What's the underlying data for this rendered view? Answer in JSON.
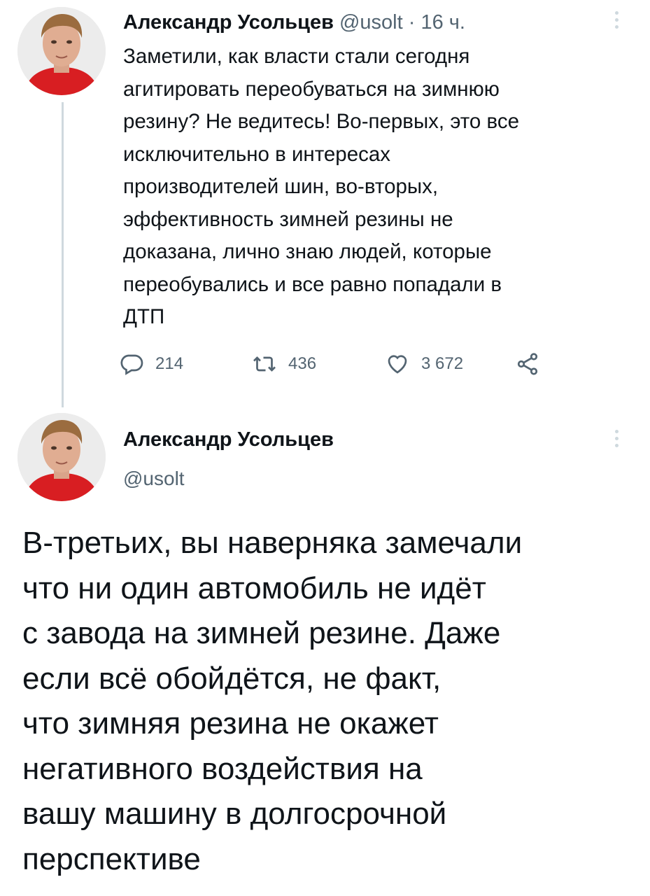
{
  "tweet1": {
    "author_name": "Александр Усольцев",
    "meta": "@usolt · 16 ч.",
    "text": "Заметили, как власти стали сегодня\nагитировать переобуваться на зимнюю\nрезину? Не ведитесь! Во-первых, это все\nисключительно в интересах\nпроизводителей шин, во-вторых,\nэффективность зимней резины не\nдоказана, лично знаю людей, которые\nпереобувались и все равно попадали в\nДТП",
    "replies": "214",
    "retweets": "436",
    "likes": "3 672"
  },
  "tweet2": {
    "author_name": "Александр Усольцев",
    "handle": "@usolt",
    "text": "В-третьих, вы наверняка замечали\nчто ни один автомобиль не идёт\nс завода на зимней резине. Даже\nесли всё обойдётся, не факт,\nчто зимняя резина не окажет\nнегативного воздействия на\nвашу машину в долгосрочной\nперспективе"
  },
  "icons": [
    "avatar",
    "more-icon",
    "reply-icon",
    "retweet-icon",
    "like-icon",
    "share-icon"
  ],
  "colors": {
    "text": "#0f1419",
    "secondary": "#536471",
    "thread_line": "#cfd9de",
    "avatar_shirt": "#d81e22"
  }
}
